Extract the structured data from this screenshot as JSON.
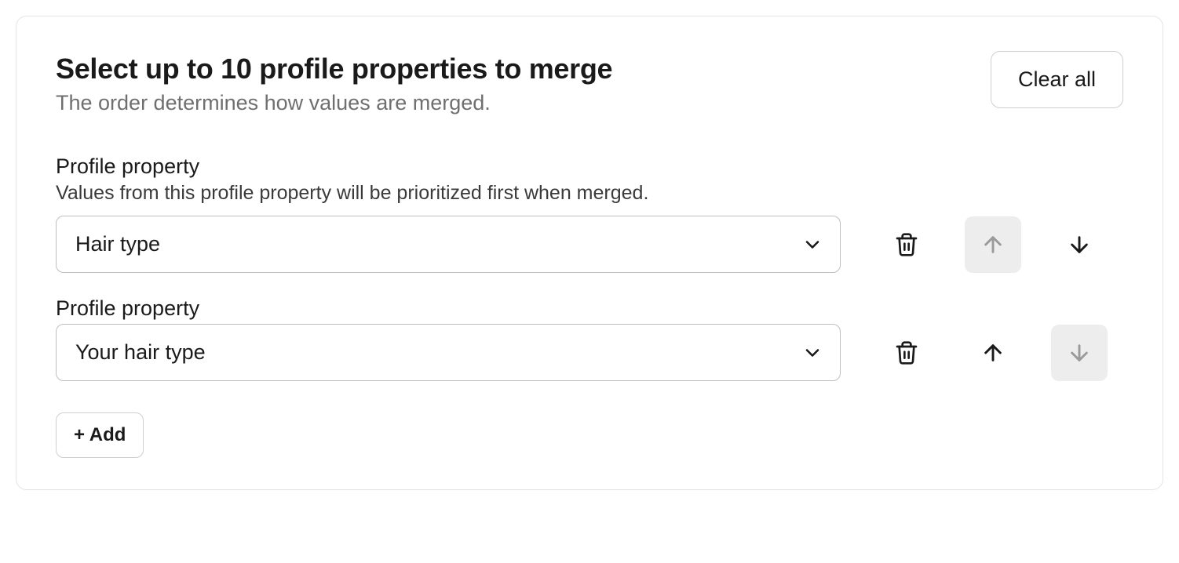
{
  "header": {
    "title": "Select up to 10 profile properties to merge",
    "subtitle": "The order determines how values are merged.",
    "clear_all_label": "Clear all"
  },
  "properties": [
    {
      "label": "Profile property",
      "hint": "Values from this profile property will be prioritized first when merged.",
      "selected_value": "Hair type",
      "up_disabled": true,
      "down_disabled": false
    },
    {
      "label": "Profile property",
      "hint": "",
      "selected_value": "Your hair type",
      "up_disabled": false,
      "down_disabled": true
    }
  ],
  "add_button_label": "+ Add"
}
